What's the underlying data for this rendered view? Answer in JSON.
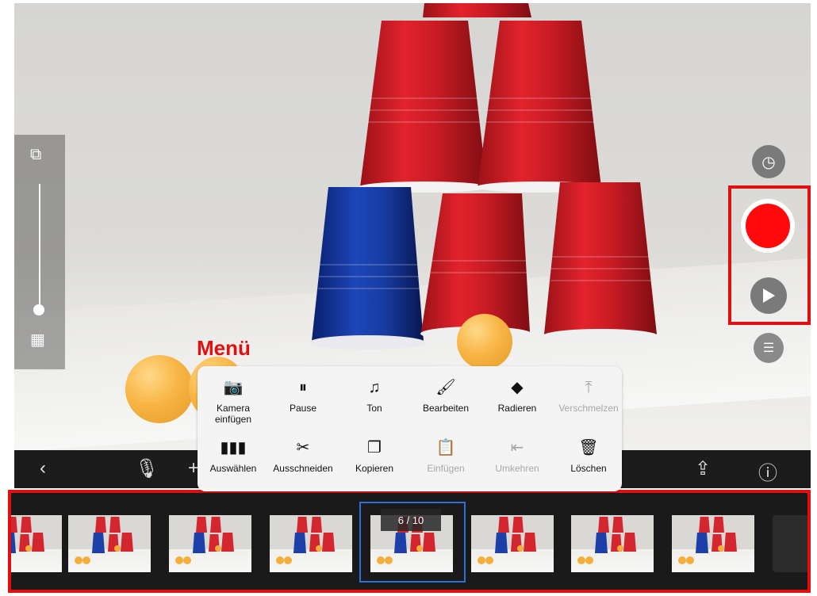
{
  "colors": {
    "highlight": "#e01010",
    "record": "#ff0a0a",
    "selection": "#2c6fd6"
  },
  "annotation": {
    "menu_label": "Menü"
  },
  "left_panel": {
    "top_icon": "onion-skin-icon",
    "bottom_icon": "grid-off-icon"
  },
  "right_panel": {
    "icons": [
      "timer-icon",
      "record-icon",
      "play-icon",
      "settings-icon"
    ]
  },
  "toolbar": {
    "icons": [
      "back-chevron-icon",
      "microphone-icon",
      "add-icon",
      "share-icon",
      "help-icon"
    ]
  },
  "menu": {
    "row1": [
      {
        "label": "Kamera\neinfügen",
        "icon": "camera-icon",
        "glyph": "📷",
        "disabled": false
      },
      {
        "label": "Pause",
        "icon": "pause-icon",
        "glyph": "⏸",
        "disabled": false
      },
      {
        "label": "Ton",
        "icon": "music-note-icon",
        "glyph": "♫",
        "disabled": false
      },
      {
        "label": "Bearbeiten",
        "icon": "brush-icon",
        "glyph": "🖌",
        "disabled": false
      },
      {
        "label": "Radieren",
        "icon": "eraser-icon",
        "glyph": "◆",
        "disabled": false
      },
      {
        "label": "Verschmelzen",
        "icon": "merge-icon",
        "glyph": "⤒",
        "disabled": true
      }
    ],
    "row2": [
      {
        "label": "Auswählen",
        "icon": "select-frames-icon",
        "glyph": "▮▮▮",
        "disabled": false
      },
      {
        "label": "Ausschneiden",
        "icon": "scissors-icon",
        "glyph": "✂",
        "disabled": false
      },
      {
        "label": "Kopieren",
        "icon": "copy-icon",
        "glyph": "❐",
        "disabled": false
      },
      {
        "label": "Einfügen",
        "icon": "paste-icon",
        "glyph": "📋",
        "disabled": true
      },
      {
        "label": "Umkehren",
        "icon": "reverse-icon",
        "glyph": "⇤",
        "disabled": true
      },
      {
        "label": "Löschen",
        "icon": "trash-icon",
        "glyph": "🗑",
        "disabled": false
      }
    ]
  },
  "filmstrip": {
    "frame_counter": "6 / 10",
    "selected_frame": 6,
    "total_frames": 10
  }
}
